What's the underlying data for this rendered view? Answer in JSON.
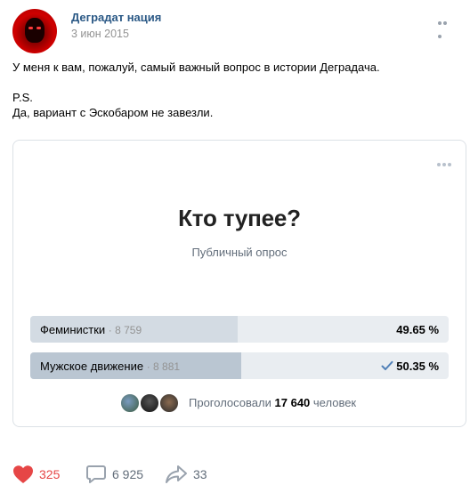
{
  "post": {
    "author": "Деградат нация",
    "date": "3 июн 2015",
    "text_lines": [
      "У меня к вам, пожалуй, самый важный вопрос в истории Деградача.",
      "",
      "P.S.",
      "Да, вариант с Эскобаром не завезли."
    ]
  },
  "poll": {
    "title": "Кто тупее?",
    "subtitle": "Публичный опрос",
    "answers": [
      {
        "label": "Феминистки",
        "count": "· 8 759",
        "percent_text": "49.65 %",
        "percent": 49.65,
        "voted": false
      },
      {
        "label": "Мужское движение",
        "count": "· 8 881",
        "percent_text": "50.35 %",
        "percent": 50.35,
        "voted": true
      }
    ],
    "voters": {
      "prefix": "Проголосовали",
      "count": "17 640",
      "suffix": "человек"
    }
  },
  "actions": {
    "likes": "325",
    "comments": "6 925",
    "shares": "33"
  },
  "colors": {
    "link": "#2a5885",
    "like": "#e64646",
    "bar_fill": "#d3dbe3",
    "bar_fill_voted": "#bac6d2",
    "bar_bg": "#e9edf1"
  }
}
